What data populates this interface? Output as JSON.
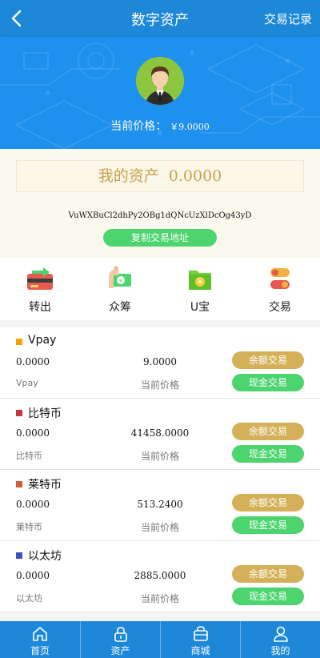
{
  "header": {
    "title": "数字资产",
    "records_label": "交易记录"
  },
  "hero": {
    "price_label": "当前价格：",
    "price_value": "￥9.0000"
  },
  "asset": {
    "label": "我的资产",
    "amount": "0.0000",
    "address": "VuWXBuCl2dhPy2OBg1dQNcUzXlDcOg43yD",
    "copy_label": "复制交易地址"
  },
  "menu": [
    {
      "label": "转出",
      "icon": "transfer-out-icon"
    },
    {
      "label": "众筹",
      "icon": "crowdfund-icon"
    },
    {
      "label": "U宝",
      "icon": "u-treasure-wallet-icon"
    },
    {
      "label": "交易",
      "icon": "trade-toggle-icon"
    }
  ],
  "coins": [
    {
      "name": "Vpay",
      "color": "#f0a30a",
      "balance": "0.0000",
      "sub": "Vpay",
      "price": "9.0000",
      "price_label": "当前价格",
      "btn1": "余额交易",
      "btn2": "现金交易"
    },
    {
      "name": "比特币",
      "color": "#c0393b",
      "balance": "0.0000",
      "sub": "比特币",
      "price": "41458.0000",
      "price_label": "当前价格",
      "btn1": "余额交易",
      "btn2": "现金交易"
    },
    {
      "name": "莱特币",
      "color": "#d0603a",
      "balance": "0.0000",
      "sub": "莱特币",
      "price": "513.2400",
      "price_label": "当前价格",
      "btn1": "余额交易",
      "btn2": "现金交易"
    },
    {
      "name": "以太坊",
      "color": "#3a56c0",
      "balance": "0.0000",
      "sub": "以太坊",
      "price": "2885.0000",
      "price_label": "当前价格",
      "btn1": "余额交易",
      "btn2": "现金交易"
    }
  ],
  "tabs": [
    {
      "label": "首页",
      "icon": "home-icon"
    },
    {
      "label": "资产",
      "icon": "lock-icon"
    },
    {
      "label": "商城",
      "icon": "shop-bag-icon"
    },
    {
      "label": "我的",
      "icon": "user-icon"
    }
  ]
}
